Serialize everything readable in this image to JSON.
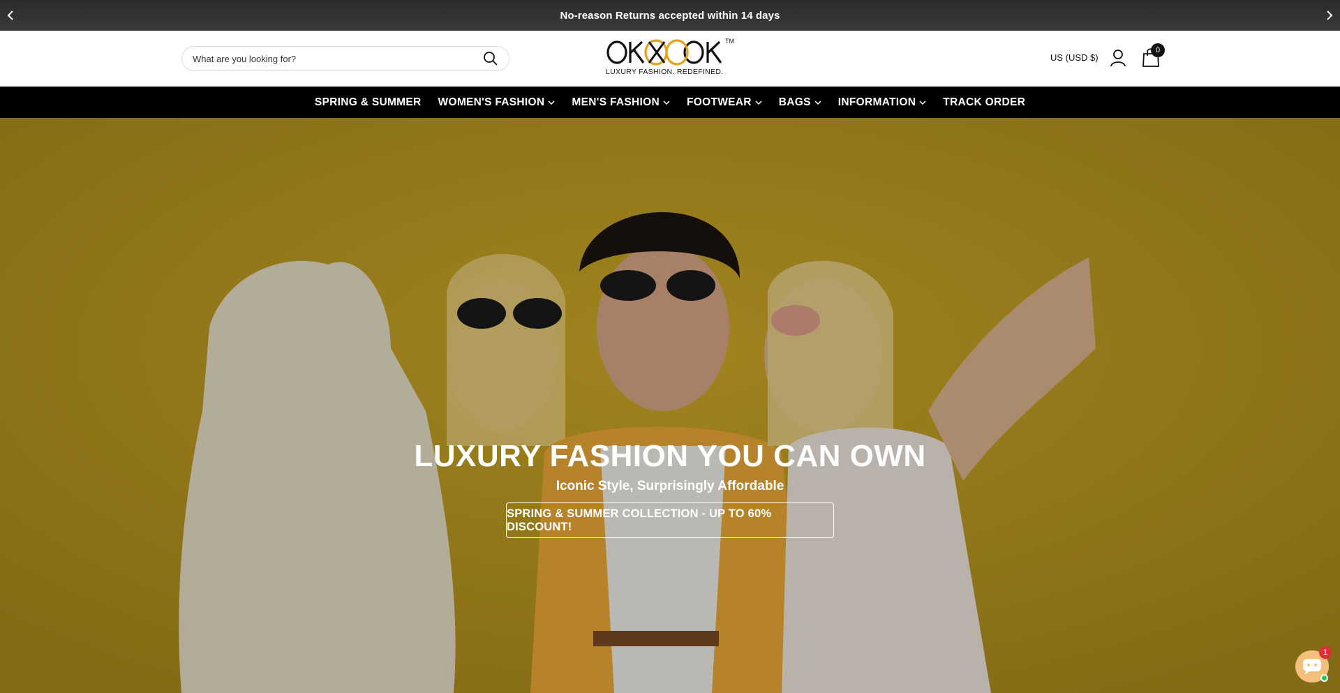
{
  "announcement": {
    "text": "No-reason Returns accepted within 14 days",
    "prev_icon": "chevron-left-icon",
    "next_icon": "chevron-right-icon"
  },
  "header": {
    "search_placeholder": "What are you looking for?",
    "search_icon": "search-icon",
    "logo": {
      "wordmark": "OKOKOKO",
      "tagline": "LUXURY FASHION. REDEFINED.",
      "tm": "TM"
    },
    "currency": "US (USD $)",
    "account_icon": "user-icon",
    "cart_icon": "shopping-bag-icon",
    "cart_count": "0"
  },
  "nav": {
    "items": [
      {
        "label": "SPRING & SUMMER",
        "dropdown": false
      },
      {
        "label": "WOMEN'S FASHION",
        "dropdown": true
      },
      {
        "label": "MEN'S FASHION",
        "dropdown": true
      },
      {
        "label": "FOOTWEAR",
        "dropdown": true
      },
      {
        "label": "BAGS",
        "dropdown": true
      },
      {
        "label": "INFORMATION",
        "dropdown": true
      },
      {
        "label": "TRACK ORDER",
        "dropdown": false
      }
    ]
  },
  "hero": {
    "title": "LUXURY FASHION YOU CAN OWN",
    "subtitle": "Iconic Style, Surprisingly Affordable",
    "cta": "SPRING & SUMMER COLLECTION - UP TO 60% DISCOUNT!",
    "background_color": "#c9a623"
  },
  "chat": {
    "icon": "chat-bot-icon",
    "badge": "1"
  },
  "colors": {
    "nav_bg": "#000000",
    "announce_bg": "#333333",
    "logo_accent": "#e3a21a",
    "chat_badge": "#d9303a",
    "online": "#21c85a"
  }
}
